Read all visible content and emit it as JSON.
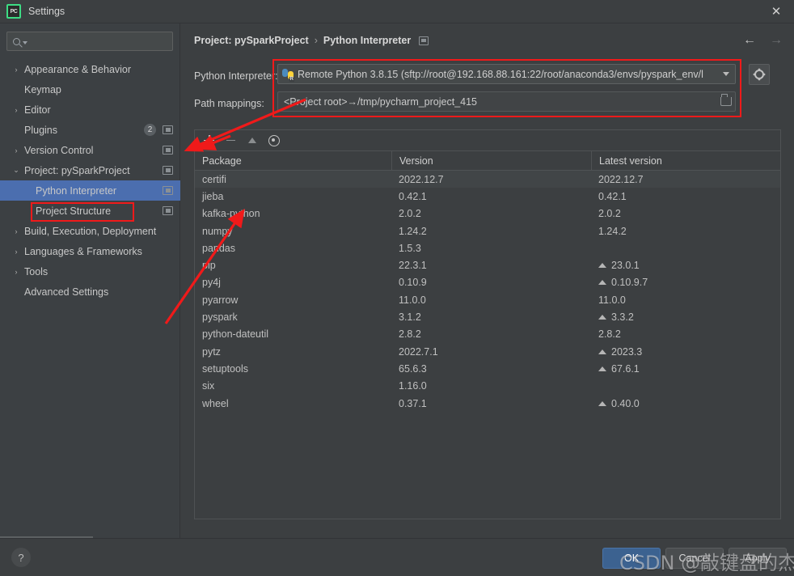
{
  "window": {
    "title": "Settings",
    "logo_text": "PC",
    "close_label": "✕"
  },
  "sidebar": {
    "search": {
      "value": "",
      "placeholder": ""
    },
    "items": [
      {
        "label": "Appearance & Behavior",
        "arrow": "›",
        "indent": 30,
        "selected": false,
        "has_icon": false,
        "badge": null
      },
      {
        "label": "Keymap",
        "arrow": "",
        "indent": 30,
        "selected": false,
        "has_icon": false,
        "badge": null
      },
      {
        "label": "Editor",
        "arrow": "›",
        "indent": 30,
        "selected": false,
        "has_icon": false,
        "badge": null
      },
      {
        "label": "Plugins",
        "arrow": "",
        "indent": 30,
        "selected": false,
        "has_icon": true,
        "badge": "2"
      },
      {
        "label": "Version Control",
        "arrow": "›",
        "indent": 30,
        "selected": false,
        "has_icon": true,
        "badge": null
      },
      {
        "label": "Project: pySparkProject",
        "arrow": "⌄",
        "indent": 30,
        "selected": false,
        "has_icon": true,
        "badge": null
      },
      {
        "label": "Python Interpreter",
        "arrow": "",
        "indent": 44,
        "selected": true,
        "has_icon": true,
        "badge": null
      },
      {
        "label": "Project Structure",
        "arrow": "",
        "indent": 44,
        "selected": false,
        "has_icon": true,
        "badge": null
      },
      {
        "label": "Build, Execution, Deployment",
        "arrow": "›",
        "indent": 30,
        "selected": false,
        "has_icon": false,
        "badge": null
      },
      {
        "label": "Languages & Frameworks",
        "arrow": "›",
        "indent": 30,
        "selected": false,
        "has_icon": false,
        "badge": null
      },
      {
        "label": "Tools",
        "arrow": "›",
        "indent": 30,
        "selected": false,
        "has_icon": false,
        "badge": null
      },
      {
        "label": "Advanced Settings",
        "arrow": "",
        "indent": 30,
        "selected": false,
        "has_icon": false,
        "badge": null
      }
    ]
  },
  "breadcrumb": {
    "parent": "Project: pySparkProject",
    "separator": "›",
    "current": "Python Interpreter"
  },
  "nav": {
    "back": "←",
    "forward": "→"
  },
  "interpreter": {
    "label": "Python Interpreter:",
    "value": "Remote Python 3.8.15 (sftp://root@192.168.88.161:22/root/anaconda3/envs/pyspark_env/l",
    "icon": "python-remote-icon"
  },
  "path_mappings": {
    "label": "Path mappings:",
    "value": "<Project root>→/tmp/pycharm_project_415"
  },
  "packages": {
    "toolbar": {
      "add": "+",
      "remove": "−",
      "upgrade": "▲",
      "show_early": "◉"
    },
    "columns": [
      "Package",
      "Version",
      "Latest version"
    ],
    "rows": [
      {
        "package": "certifi",
        "version": "2022.12.7",
        "latest": "2022.12.7",
        "upgradable": false
      },
      {
        "package": "jieba",
        "version": "0.42.1",
        "latest": "0.42.1",
        "upgradable": false
      },
      {
        "package": "kafka-python",
        "version": "2.0.2",
        "latest": "2.0.2",
        "upgradable": false
      },
      {
        "package": "numpy",
        "version": "1.24.2",
        "latest": "1.24.2",
        "upgradable": false
      },
      {
        "package": "pandas",
        "version": "1.5.3",
        "latest": "",
        "upgradable": false
      },
      {
        "package": "pip",
        "version": "22.3.1",
        "latest": "23.0.1",
        "upgradable": true
      },
      {
        "package": "py4j",
        "version": "0.10.9",
        "latest": "0.10.9.7",
        "upgradable": true
      },
      {
        "package": "pyarrow",
        "version": "11.0.0",
        "latest": "11.0.0",
        "upgradable": false
      },
      {
        "package": "pyspark",
        "version": "3.1.2",
        "latest": "3.3.2",
        "upgradable": true
      },
      {
        "package": "python-dateutil",
        "version": "2.8.2",
        "latest": "2.8.2",
        "upgradable": false
      },
      {
        "package": "pytz",
        "version": "2022.7.1",
        "latest": "2023.3",
        "upgradable": true
      },
      {
        "package": "setuptools",
        "version": "65.6.3",
        "latest": "67.6.1",
        "upgradable": true
      },
      {
        "package": "six",
        "version": "1.16.0",
        "latest": "",
        "upgradable": false
      },
      {
        "package": "wheel",
        "version": "0.37.1",
        "latest": "0.40.0",
        "upgradable": true
      }
    ]
  },
  "footer": {
    "help": "?",
    "buttons": [
      {
        "label": "OK",
        "primary": true
      },
      {
        "label": "Cancel",
        "primary": false
      },
      {
        "label": "Apply",
        "primary": false
      }
    ]
  },
  "watermark": {
    "text": "CSDN @敲键盘的杰克"
  },
  "colors": {
    "panel_bg": "#3c3f41",
    "sidebar_bg": "#3c4043",
    "selection_blue": "#4b6eaf",
    "primary_button": "#3c6290",
    "annotation_red": "#f01a1a",
    "text": "#c0c0c0"
  }
}
